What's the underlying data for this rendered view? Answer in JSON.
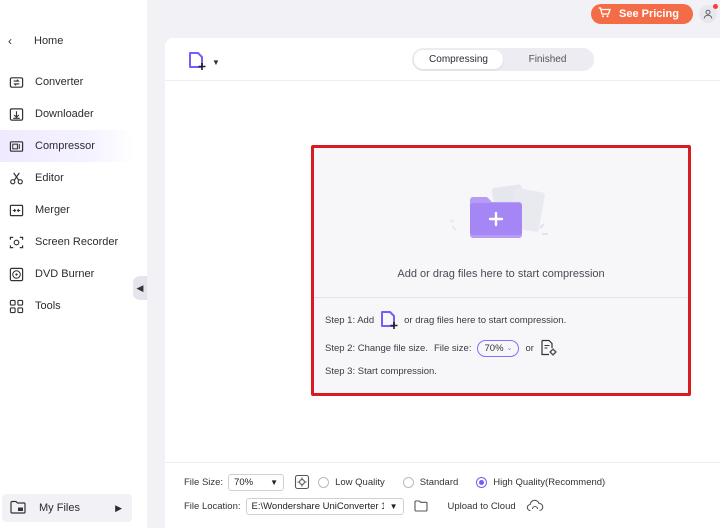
{
  "header": {
    "pricing_label": "See Pricing"
  },
  "sidebar": {
    "home_label": "Home",
    "items": [
      {
        "label": "Converter",
        "icon": "converter-icon"
      },
      {
        "label": "Downloader",
        "icon": "downloader-icon"
      },
      {
        "label": "Compressor",
        "icon": "compressor-icon",
        "active": true
      },
      {
        "label": "Editor",
        "icon": "editor-icon"
      },
      {
        "label": "Merger",
        "icon": "merger-icon"
      },
      {
        "label": "Screen Recorder",
        "icon": "screen-recorder-icon"
      },
      {
        "label": "DVD Burner",
        "icon": "dvd-burner-icon"
      },
      {
        "label": "Tools",
        "icon": "tools-icon"
      }
    ],
    "my_files_label": "My Files"
  },
  "main": {
    "tabs": [
      {
        "label": "Compressing",
        "active": true
      },
      {
        "label": "Finished",
        "active": false
      }
    ],
    "dropzone": {
      "prompt": "Add or drag files here to start compression",
      "step1_prefix": "Step 1: Add",
      "step1_suffix": "or drag files here to start compression.",
      "step2_prefix": "Step 2: Change file size.",
      "step2_filesize_label": "File size:",
      "step2_filesize_value": "70%",
      "step2_or": "or",
      "step3": "Step 3: Start compression."
    },
    "bottom": {
      "file_size_label": "File Size:",
      "file_size_value": "70%",
      "quality_options": [
        {
          "label": "Low Quality",
          "selected": false
        },
        {
          "label": "Standard",
          "selected": false
        },
        {
          "label": "High Quality(Recommend)",
          "selected": true
        }
      ],
      "file_location_label": "File Location:",
      "file_location_value": "E:\\Wondershare UniConverter 1",
      "upload_label": "Upload to Cloud"
    }
  },
  "colors": {
    "accent": "#8b6cf6",
    "pricing": "#f46c47",
    "highlight_border": "#d81d22"
  }
}
